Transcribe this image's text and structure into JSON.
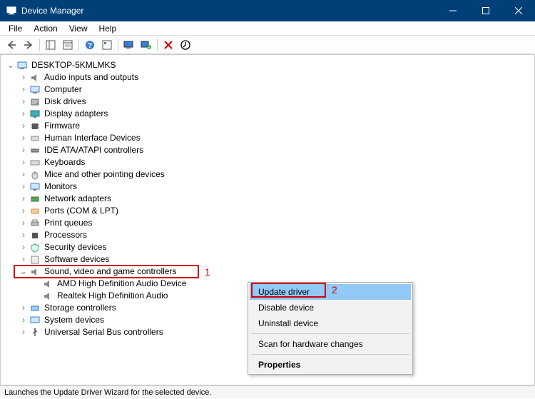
{
  "window": {
    "title": "Device Manager"
  },
  "menubar": {
    "file": "File",
    "action": "Action",
    "view": "View",
    "help": "Help"
  },
  "tree": {
    "root": "DESKTOP-5KMLMKS",
    "items": [
      "Audio inputs and outputs",
      "Computer",
      "Disk drives",
      "Display adapters",
      "Firmware",
      "Human Interface Devices",
      "IDE ATA/ATAPI controllers",
      "Keyboards",
      "Mice and other pointing devices",
      "Monitors",
      "Network adapters",
      "Ports (COM & LPT)",
      "Print queues",
      "Processors",
      "Security devices",
      "Software devices"
    ],
    "sound_category": "Sound, video and game controllers",
    "sound_children": [
      "AMD High Definition Audio Device",
      "Realtek High Definition Audio"
    ],
    "items_after": [
      "Storage controllers",
      "System devices",
      "Universal Serial Bus controllers"
    ]
  },
  "annotations": {
    "one": "1",
    "two": "2"
  },
  "context_menu": {
    "update": "Update driver",
    "disable": "Disable device",
    "uninstall": "Uninstall device",
    "scan": "Scan for hardware changes",
    "properties": "Properties"
  },
  "statusbar": {
    "text": "Launches the Update Driver Wizard for the selected device."
  }
}
